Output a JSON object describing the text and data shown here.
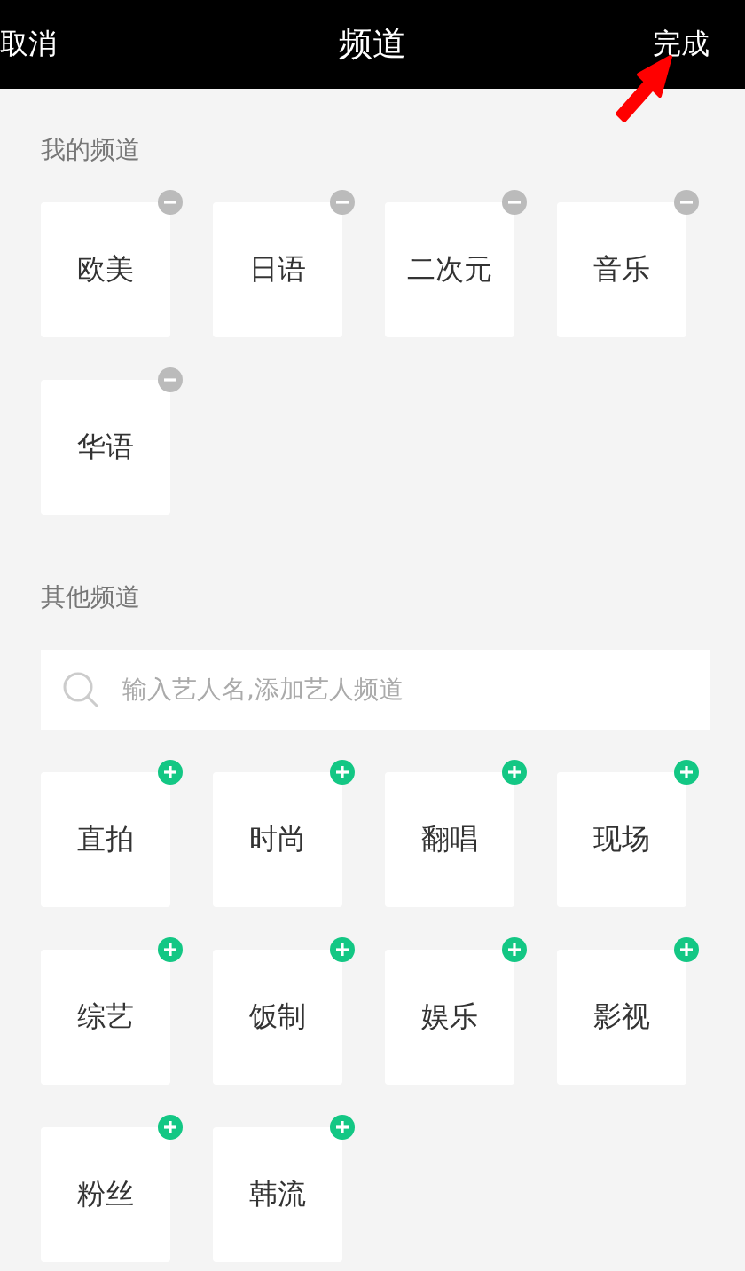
{
  "header": {
    "cancel": "取消",
    "title": "频道",
    "done": "完成"
  },
  "my_channels": {
    "title": "我的频道",
    "items": [
      {
        "label": "欧美",
        "kind": "removable"
      },
      {
        "label": "日语",
        "kind": "removable"
      },
      {
        "label": "二次元",
        "kind": "removable"
      },
      {
        "label": "音乐",
        "kind": "removable"
      },
      {
        "label": "华语",
        "kind": "removable"
      }
    ]
  },
  "other_channels": {
    "title": "其他频道",
    "search": {
      "placeholder": "输入艺人名,添加艺人频道"
    },
    "items": [
      {
        "label": "直拍",
        "kind": "addable"
      },
      {
        "label": "时尚",
        "kind": "addable"
      },
      {
        "label": "翻唱",
        "kind": "addable"
      },
      {
        "label": "现场",
        "kind": "addable"
      },
      {
        "label": "综艺",
        "kind": "addable"
      },
      {
        "label": "饭制",
        "kind": "addable"
      },
      {
        "label": "娱乐",
        "kind": "addable"
      },
      {
        "label": "影视",
        "kind": "addable"
      },
      {
        "label": "粉丝",
        "kind": "addable"
      },
      {
        "label": "韩流",
        "kind": "addable"
      }
    ]
  }
}
